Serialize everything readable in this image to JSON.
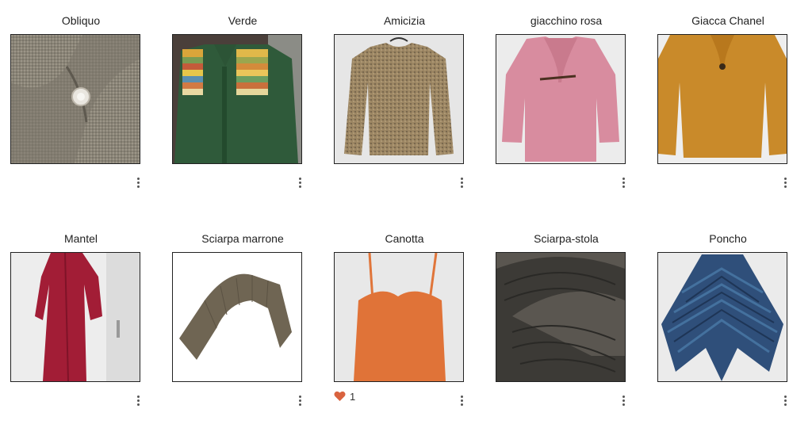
{
  "items": [
    {
      "title": "Obliquo"
    },
    {
      "title": "Verde"
    },
    {
      "title": "Amicizia"
    },
    {
      "title": "giacchino rosa"
    },
    {
      "title": "Giacca Chanel"
    },
    {
      "title": "Mantel"
    },
    {
      "title": "Sciarpa marrone"
    },
    {
      "title": "Canotta"
    },
    {
      "title": "Sciarpa-stola"
    },
    {
      "title": "Poncho"
    }
  ],
  "likes": {
    "canotta_count": "1",
    "heart_color": "#d9633f"
  },
  "icons": {
    "more": "more-vertical-icon",
    "like": "heart-icon"
  }
}
